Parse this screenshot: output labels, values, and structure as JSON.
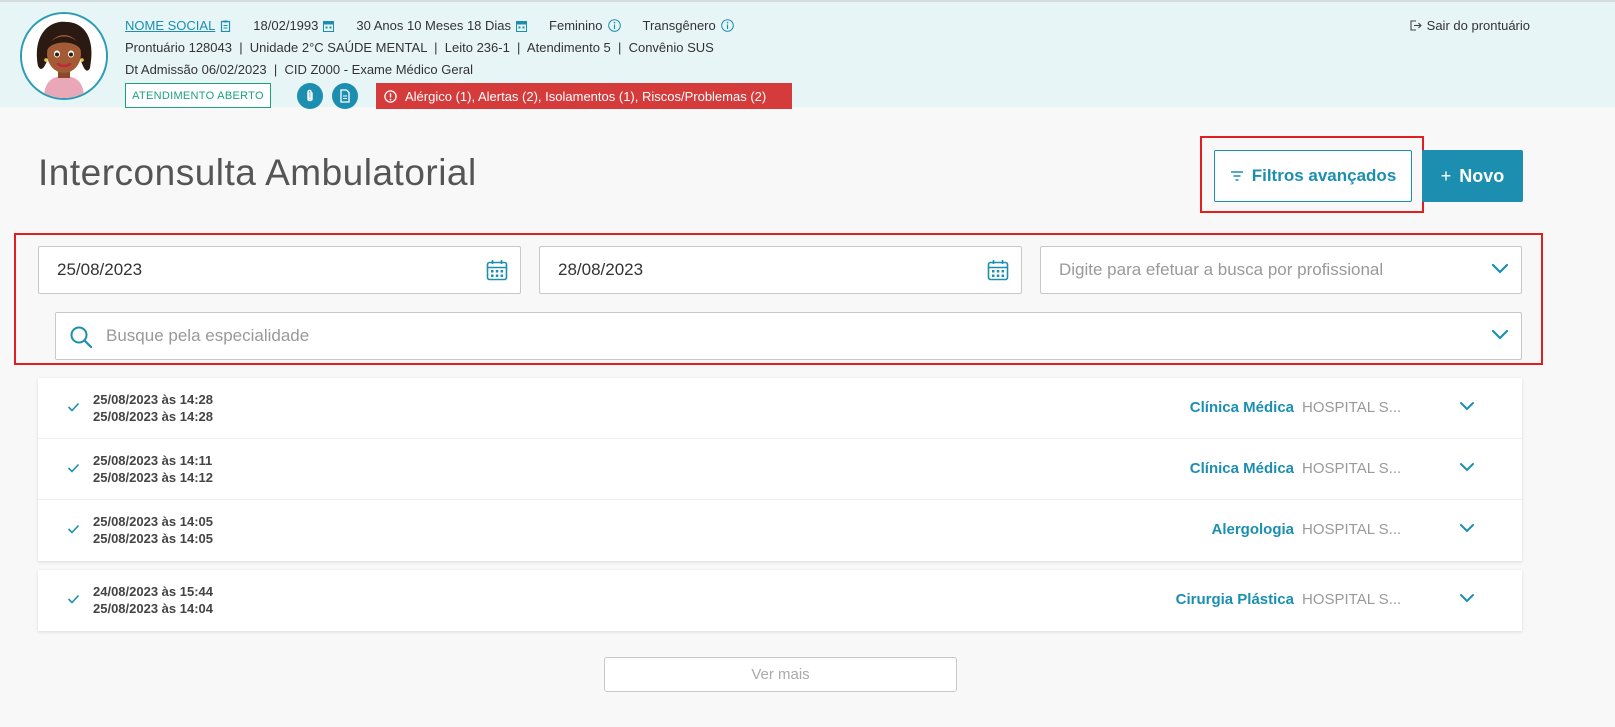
{
  "patient": {
    "social_name": "NOME SOCIAL",
    "birth_date": "18/02/1993",
    "age": "30 Anos 10 Meses 18 Dias",
    "sex": "Feminino",
    "gender": "Transgênero",
    "line2": "Prontuário 128043  |  Unidade 2°C SAÚDE MENTAL  |  Leito 236-1  |  Atendimento 5  |  Convênio SUS",
    "line3": "Dt Admissão 06/02/2023  |  CID Z000 - Exame Médico Geral",
    "status": "ATENDIMENTO ABERTO",
    "alerts": "Alérgico (1),  Alertas (2),  Isolamentos (1),  Riscos/Problemas (2)",
    "logout": "Sair do prontuário"
  },
  "page": {
    "title": "Interconsulta Ambulatorial",
    "filters_label": "Filtros avançados",
    "new_label": "Novo",
    "new_icon": "+",
    "more_label": "Ver mais"
  },
  "filters": {
    "start_date": "25/08/2023",
    "end_date": "28/08/2023",
    "professional_placeholder": "Digite para efetuar a busca por profissional",
    "specialty_placeholder": "Busque pela especialidade"
  },
  "items": [
    {
      "start": "25/08/2023 às 14:28",
      "end": "25/08/2023 às 14:28",
      "specialty": "Clínica Médica",
      "hospital": "HOSPITAL S..."
    },
    {
      "start": "25/08/2023 às 14:11",
      "end": "25/08/2023 às 14:12",
      "specialty": "Clínica Médica",
      "hospital": "HOSPITAL S..."
    },
    {
      "start": "25/08/2023 às 14:05",
      "end": "25/08/2023 às 14:05",
      "specialty": "Alergologia",
      "hospital": "HOSPITAL S..."
    },
    {
      "start": "24/08/2023 às 15:44",
      "end": "25/08/2023 às 14:04",
      "specialty": "Cirurgia Plástica",
      "hospital": "HOSPITAL S..."
    }
  ],
  "colors": {
    "accent": "#1c8fb0",
    "alert": "#d63b3b",
    "status": "#1aa37a",
    "header_bg": "#e7f5f7"
  }
}
